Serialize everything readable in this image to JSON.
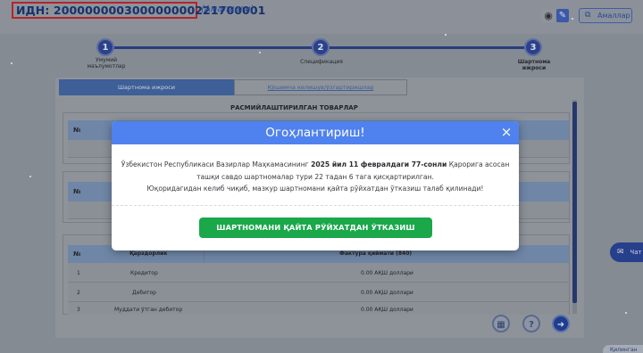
{
  "header": {
    "idn": "ИДН: 200000000300000000221700001",
    "status": "(Амалдаги)",
    "eye_icon": "eye-icon",
    "edit_icon": "pencil-icon",
    "active_button": "Амаллар"
  },
  "stepper": {
    "steps": [
      {
        "number": "1",
        "label_1": "Умумий",
        "label_2": "маълумотлар"
      },
      {
        "number": "2",
        "label_1": "Спецификация",
        "label_2": ""
      },
      {
        "number": "3",
        "label_1": "Шартнома",
        "label_2": "ижроси"
      }
    ]
  },
  "tabs": {
    "tab1": "Шартнома ижроси",
    "tab2": "Қўшимча келишув/ўзгартиришлар"
  },
  "main": {
    "section_title": "РАСМИЙЛАШТИРИЛГАН ТОВАРЛАР",
    "col_num": "№",
    "bottom_table": {
      "col_num": "№",
      "col_name": "Қарздорлик",
      "col_amount": "Фактура қиймати (840)",
      "rows": [
        {
          "num": "1",
          "name": "Кредитор",
          "amount": "0.00 АҚШ доллари"
        },
        {
          "num": "2",
          "name": "Дебитор",
          "amount": "0.00 АҚШ доллари"
        },
        {
          "num": "3",
          "name": "Муддати ўтган дебитор",
          "amount": "0.00 АҚШ доллари"
        }
      ]
    }
  },
  "modal": {
    "title": "Огоҳлантириш!",
    "close": "×",
    "line1_a": "Ўзбекистон Республикаси Вазирлар Маҳкамасининг ",
    "line1_b": "2025 йил 11 февралдаги 77-сонли",
    "line1_c": " Қарорига асосан",
    "line2": "ташқи савдо шартномалар тури 22 тадан 6 тага қисқартирилган.",
    "line3": "Юқоридагидан келиб чиқиб, мазкур шартномани қайта рўйхатдан ўтказиш талаб қилинади!",
    "action": "ШАРТНОМАНИ ҚАЙТА РЎЙХАТДАН ЎТКАЗИШ"
  },
  "floating": {
    "chat_label": "Чат",
    "chat2_label": "Қилинган",
    "qr_icon": "qr-code-icon",
    "help_icon": "question-icon",
    "back_icon": "arrow-left-icon"
  }
}
